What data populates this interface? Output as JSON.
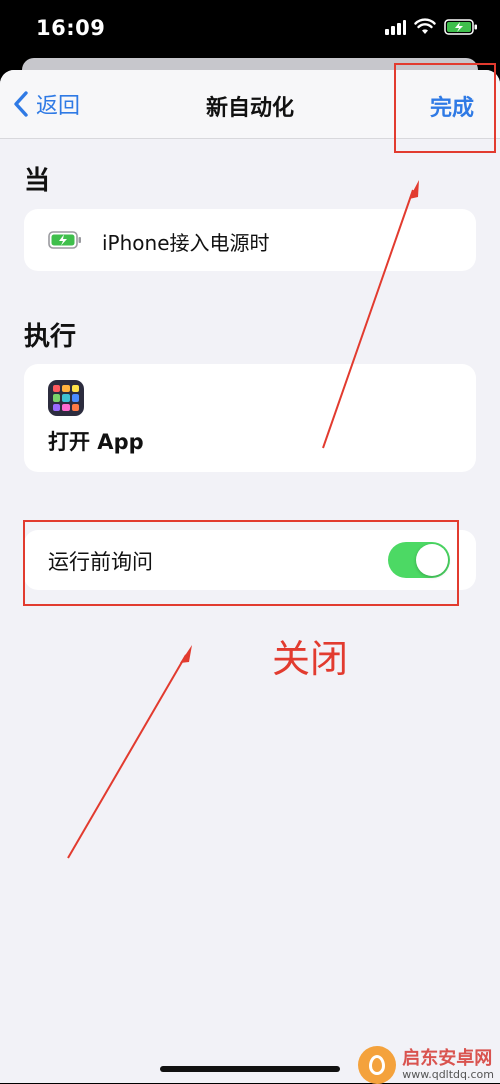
{
  "status_bar": {
    "time": "16:09",
    "icons": [
      "signal-icon",
      "wifi-icon",
      "battery-charging-icon"
    ]
  },
  "nav": {
    "back_label": "返回",
    "title": "新自动化",
    "done_label": "完成"
  },
  "trigger_section": {
    "label": "当",
    "item_text": "iPhone接入电源时",
    "item_icon": "battery-charging-icon"
  },
  "action_section": {
    "label": "执行",
    "item_text": "打开 App",
    "item_icon": "app-grid-icon"
  },
  "ask_before_running": {
    "label": "运行前询问",
    "toggle_on": true
  },
  "annotation": {
    "text": "关闭",
    "color": "#e23b2f"
  },
  "watermark": {
    "title": "启东安卓网",
    "url": "www.qdltdq.com"
  },
  "colors": {
    "accent": "#2f7ae5",
    "toggle_on": "#4cd964",
    "battery_green": "#3fbf4c"
  }
}
